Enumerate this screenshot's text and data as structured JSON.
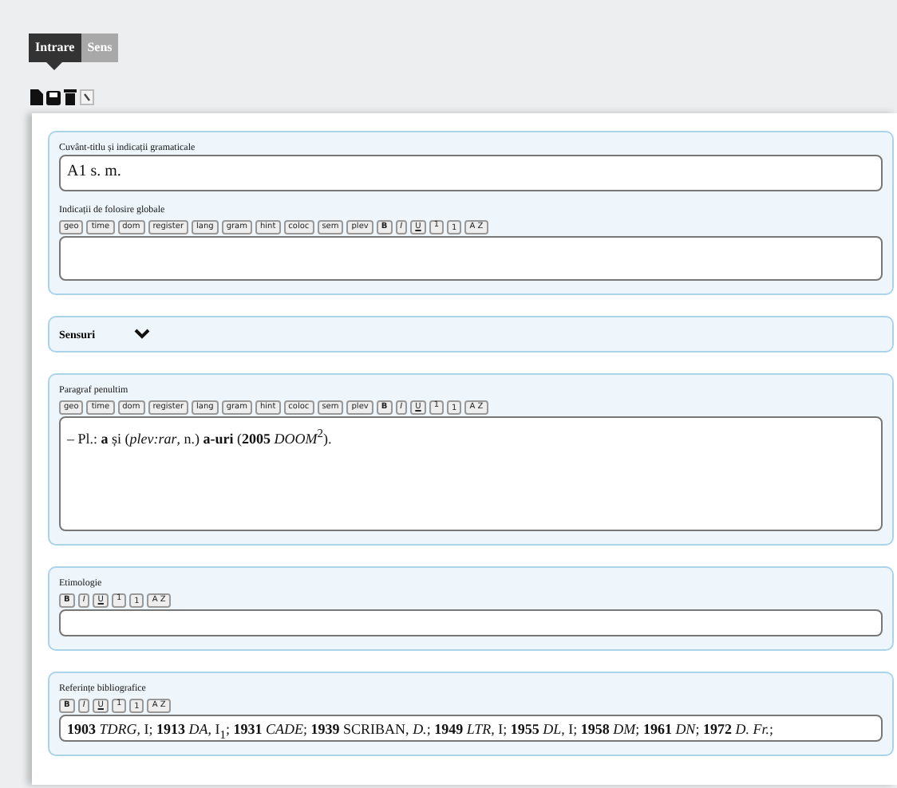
{
  "tabs": [
    {
      "label": "Intrare",
      "selected": true
    },
    {
      "label": "Sens",
      "selected": false
    }
  ],
  "sections": [
    {
      "kind": "fields",
      "fields": [
        {
          "label": "Cuvânt-titlu și indicații gramaticale",
          "kind": "line",
          "value": "A1 s. m."
        },
        {
          "label": "Indicații de folosire globale",
          "kind": "box",
          "buttons": [
            {
              "label": "geo",
              "kind": "plain"
            },
            {
              "label": "time",
              "kind": "plain"
            },
            {
              "label": "dom",
              "kind": "plain"
            },
            {
              "label": "register",
              "kind": "plain"
            },
            {
              "label": "lang",
              "kind": "plain"
            },
            {
              "label": "gram",
              "kind": "plain"
            },
            {
              "label": "hint",
              "kind": "plain"
            },
            {
              "label": "coloc",
              "kind": "plain"
            },
            {
              "label": "sem",
              "kind": "plain"
            },
            {
              "label": "plev",
              "kind": "plain"
            },
            {
              "label": "B",
              "kind": "bold"
            },
            {
              "label": "I",
              "kind": "italic"
            },
            {
              "label": "U",
              "kind": "underline"
            },
            {
              "label": "1",
              "kind": "sup"
            },
            {
              "label": "1",
              "kind": "sub"
            },
            {
              "label": "A Z",
              "kind": "plain"
            }
          ]
        }
      ]
    },
    {
      "kind": "collapsible",
      "title": "Sensuri",
      "expanded": false
    },
    {
      "kind": "fields",
      "fields": [
        {
          "label": "Paragraf penultim",
          "kind": "area",
          "buttons": [
            {
              "label": "geo",
              "kind": "plain"
            },
            {
              "label": "time",
              "kind": "plain"
            },
            {
              "label": "dom",
              "kind": "plain"
            },
            {
              "label": "register",
              "kind": "plain"
            },
            {
              "label": "lang",
              "kind": "plain"
            },
            {
              "label": "gram",
              "kind": "plain"
            },
            {
              "label": "hint",
              "kind": "plain"
            },
            {
              "label": "coloc",
              "kind": "plain"
            },
            {
              "label": "sem",
              "kind": "plain"
            },
            {
              "label": "plev",
              "kind": "plain"
            },
            {
              "label": "B",
              "kind": "bold"
            },
            {
              "label": "I",
              "kind": "italic"
            },
            {
              "label": "U",
              "kind": "underline"
            },
            {
              "label": "1",
              "kind": "sup"
            },
            {
              "label": "1",
              "kind": "sub"
            },
            {
              "label": "A Z",
              "kind": "plain"
            }
          ],
          "value": "– Pl.: **a** și (*plev:rar*, n.) **a-uri** (**2005** *DOOM*$^{2}$)."
        }
      ]
    },
    {
      "kind": "fields",
      "fields": [
        {
          "label": "Etimologie",
          "kind": "short",
          "buttons": [
            {
              "label": "B",
              "kind": "bold"
            },
            {
              "label": "I",
              "kind": "italic"
            },
            {
              "label": "U",
              "kind": "underline"
            },
            {
              "label": "1",
              "kind": "sup"
            },
            {
              "label": "1",
              "kind": "sub"
            },
            {
              "label": "A Z",
              "kind": "plain"
            }
          ]
        }
      ]
    },
    {
      "kind": "fields",
      "fields": [
        {
          "label": "Referințe bibliografice",
          "kind": "short",
          "buttons": [
            {
              "label": "B",
              "kind": "bold"
            },
            {
              "label": "I",
              "kind": "italic"
            },
            {
              "label": "U",
              "kind": "underline"
            },
            {
              "label": "1",
              "kind": "sup"
            },
            {
              "label": "1",
              "kind": "sub"
            },
            {
              "label": "A Z",
              "kind": "plain"
            }
          ],
          "value": "**1903** *TDRG*, I; **1913** *DA*, I$_{1}$; **1931** *CADE*; **1939** SCRIBAN, *D.*; **1949** *LTR*, I; **1955** *DL*, I; **1958** *DM*; **1961** *DN*; **1972** *D. Fr.*;"
        }
      ]
    }
  ]
}
